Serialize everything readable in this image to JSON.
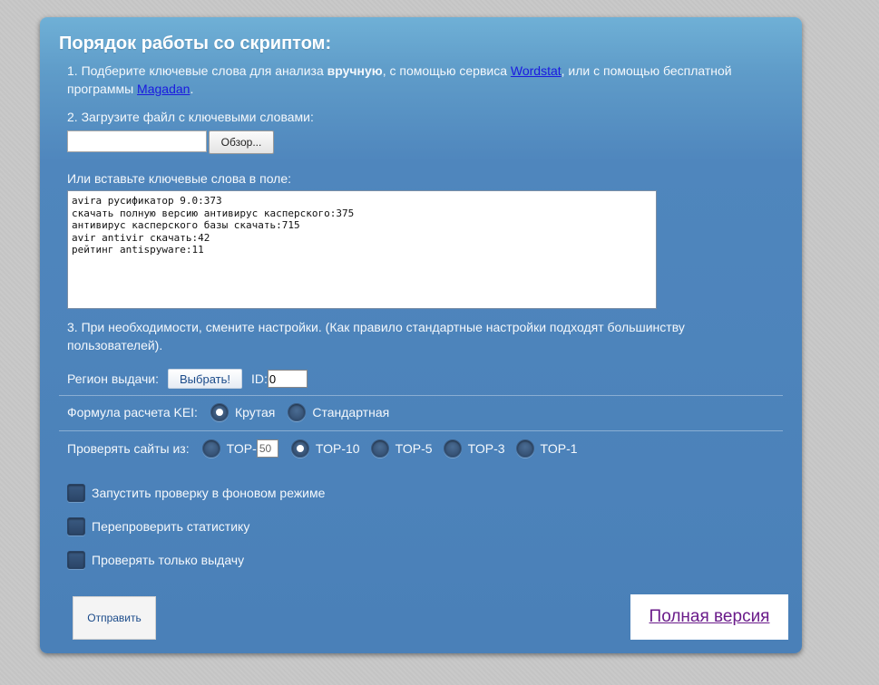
{
  "title": "Порядок работы со скриптом:",
  "step1": {
    "text_a": "1. Подберите ключевые слова для анализа ",
    "text_bold": "вручную",
    "text_b": ", с помощью сервиса ",
    "link_wordstat": "Wordstat",
    "text_c": ", или с помощью бесплатной программы ",
    "link_magadan": "Magadan",
    "text_d": "."
  },
  "step2": {
    "text": "2. Загрузите файл с ключевыми словами:",
    "browse_label": "Обзор..."
  },
  "paste": {
    "label": "Или вставьте ключевые слова в поле:",
    "keywords": "avira русификатор 9.0:373\nскачать полную версию антивирус касперского:375\nантивирус касперского базы скачать:715\navir antivir скачать:42\nрейтинг antispyware:11"
  },
  "step3": {
    "text": "3. При необходимости, смените настройки. (Как правило стандартные настройки подходят большинству пользователей)."
  },
  "region": {
    "label": "Регион выдачи:",
    "choose_label": "Выбрать!",
    "id_label": "ID:",
    "id_value": "0"
  },
  "kei": {
    "label": "Формула расчета KEI:",
    "options": [
      {
        "label": "Крутая",
        "checked": true
      },
      {
        "label": "Стандартная",
        "checked": false
      }
    ]
  },
  "top": {
    "label": "Проверять сайты из:",
    "custom_prefix": "TOP-",
    "custom_value": "50",
    "options": [
      {
        "label": "TOP-10",
        "checked": true
      },
      {
        "label": "TOP-5",
        "checked": false
      },
      {
        "label": "TOP-3",
        "checked": false
      },
      {
        "label": "TOP-1",
        "checked": false
      }
    ]
  },
  "checkboxes": [
    {
      "label": "Запустить проверку в фоновом режиме",
      "checked": false
    },
    {
      "label": "Перепроверить статистику",
      "checked": false
    },
    {
      "label": "Проверять только выдачу",
      "checked": false
    }
  ],
  "submit_label": "Отправить",
  "full_version_label": "Полная версия"
}
